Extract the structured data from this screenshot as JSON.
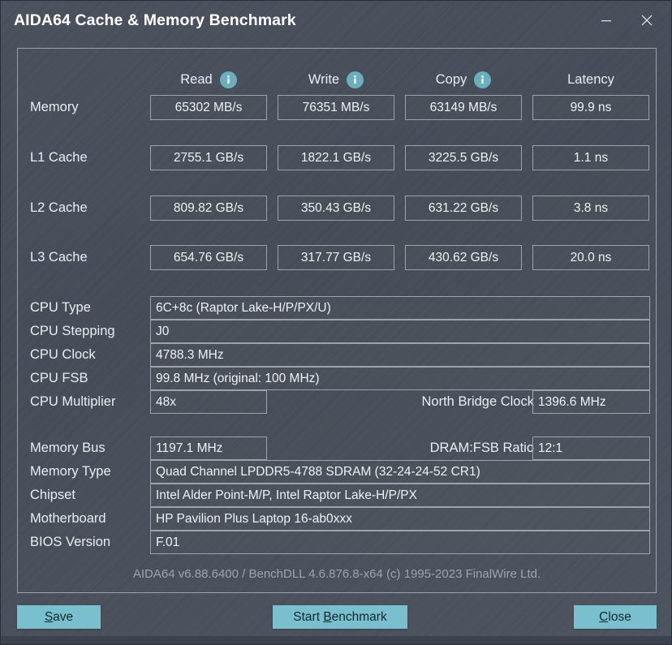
{
  "window": {
    "title": "AIDA64 Cache & Memory Benchmark",
    "minimize_label": "Minimize",
    "close_label": "Close",
    "accent_color": "#79bfcd",
    "background_color": "#4d535f",
    "border_color": "#99a2ad"
  },
  "benchmark": {
    "columns": [
      {
        "label": "Read",
        "has_info": true
      },
      {
        "label": "Write",
        "has_info": true
      },
      {
        "label": "Copy",
        "has_info": true
      },
      {
        "label": "Latency",
        "has_info": false
      }
    ],
    "rows": [
      {
        "label": "Memory",
        "read": "65302 MB/s",
        "write": "76351 MB/s",
        "copy": "63149 MB/s",
        "latency": "99.9 ns"
      },
      {
        "label": "L1 Cache",
        "read": "2755.1 GB/s",
        "write": "1822.1 GB/s",
        "copy": "3225.5 GB/s",
        "latency": "1.1 ns"
      },
      {
        "label": "L2 Cache",
        "read": "809.82 GB/s",
        "write": "350.43 GB/s",
        "copy": "631.22 GB/s",
        "latency": "3.8 ns"
      },
      {
        "label": "L3 Cache",
        "read": "654.76 GB/s",
        "write": "317.77 GB/s",
        "copy": "430.62 GB/s",
        "latency": "20.0 ns"
      }
    ]
  },
  "cpu_info": {
    "type_label": "CPU Type",
    "type_value": "6C+8c   (Raptor Lake-H/P/PX/U)",
    "stepping_label": "CPU Stepping",
    "stepping_value": "J0",
    "clock_label": "CPU Clock",
    "clock_value": "4788.3 MHz",
    "fsb_label": "CPU FSB",
    "fsb_value": "99.8 MHz  (original: 100 MHz)",
    "multiplier_label": "CPU Multiplier",
    "multiplier_value": "48x",
    "north_bridge_label": "North Bridge Clock",
    "north_bridge_value": "1396.6 MHz"
  },
  "memory_info": {
    "bus_label": "Memory Bus",
    "bus_value": "1197.1 MHz",
    "dram_ratio_label": "DRAM:FSB Ratio",
    "dram_ratio_value": "12:1",
    "type_label": "Memory Type",
    "type_value": "Quad Channel LPDDR5-4788 SDRAM  (32-24-24-52 CR1)",
    "chipset_label": "Chipset",
    "chipset_value": "Intel Alder Point-M/P, Intel Raptor Lake-H/P/PX",
    "motherboard_label": "Motherboard",
    "motherboard_value": "HP Pavilion Plus Laptop 16-ab0xxx",
    "bios_label": "BIOS Version",
    "bios_value": "F.01"
  },
  "footer": {
    "note": "AIDA64 v6.88.6400 / BenchDLL 4.6.876.8-x64  (c) 1995-2023 FinalWire Ltd."
  },
  "actions": {
    "save": {
      "pre": "",
      "accel": "S",
      "post": "ave"
    },
    "start_benchmark": {
      "pre": "Start ",
      "accel": "B",
      "post": "enchmark"
    },
    "close": {
      "pre": "",
      "accel": "C",
      "post": "lose"
    }
  }
}
